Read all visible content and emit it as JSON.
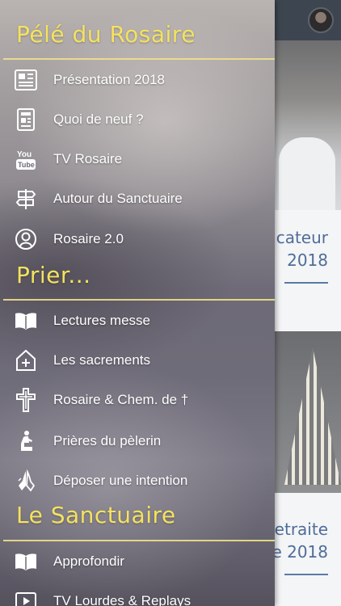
{
  "background_page": {
    "card1_title_line1": "icateur",
    "card1_title_line2": "2018",
    "card2_title_line1": "etraite",
    "card2_title_line2": "e 2018"
  },
  "drawer": {
    "sections": [
      {
        "title": "Pélé du Rosaire",
        "items": [
          {
            "label": "Présentation 2018",
            "icon": "newspaper-icon"
          },
          {
            "label": "Quoi de neuf ?",
            "icon": "news-icon"
          },
          {
            "label": "TV Rosaire",
            "icon": "youtube-icon"
          },
          {
            "label": "Autour du Sanctuaire",
            "icon": "signpost-icon"
          },
          {
            "label": "Rosaire 2.0",
            "icon": "user-circle-icon"
          }
        ]
      },
      {
        "title": "Prier...",
        "items": [
          {
            "label": "Lectures messe",
            "icon": "book-icon"
          },
          {
            "label": "Les sacrements",
            "icon": "church-plus-icon"
          },
          {
            "label": "Rosaire & Chem. de †",
            "icon": "cross-icon"
          },
          {
            "label": "Prières du pèlerin",
            "icon": "kneeling-person-icon"
          },
          {
            "label": "Déposer une intention",
            "icon": "praying-hands-icon"
          }
        ]
      },
      {
        "title": "Le Sanctuaire",
        "items": [
          {
            "label": "Approfondir",
            "icon": "book-icon"
          },
          {
            "label": "TV Lourdes & Replays",
            "icon": "play-icon"
          }
        ]
      }
    ]
  },
  "colors": {
    "section_title": "#f4e25e",
    "section_rule": "#efe08a",
    "item_text": "#ffffff",
    "bg_title": "#4f6d98"
  }
}
